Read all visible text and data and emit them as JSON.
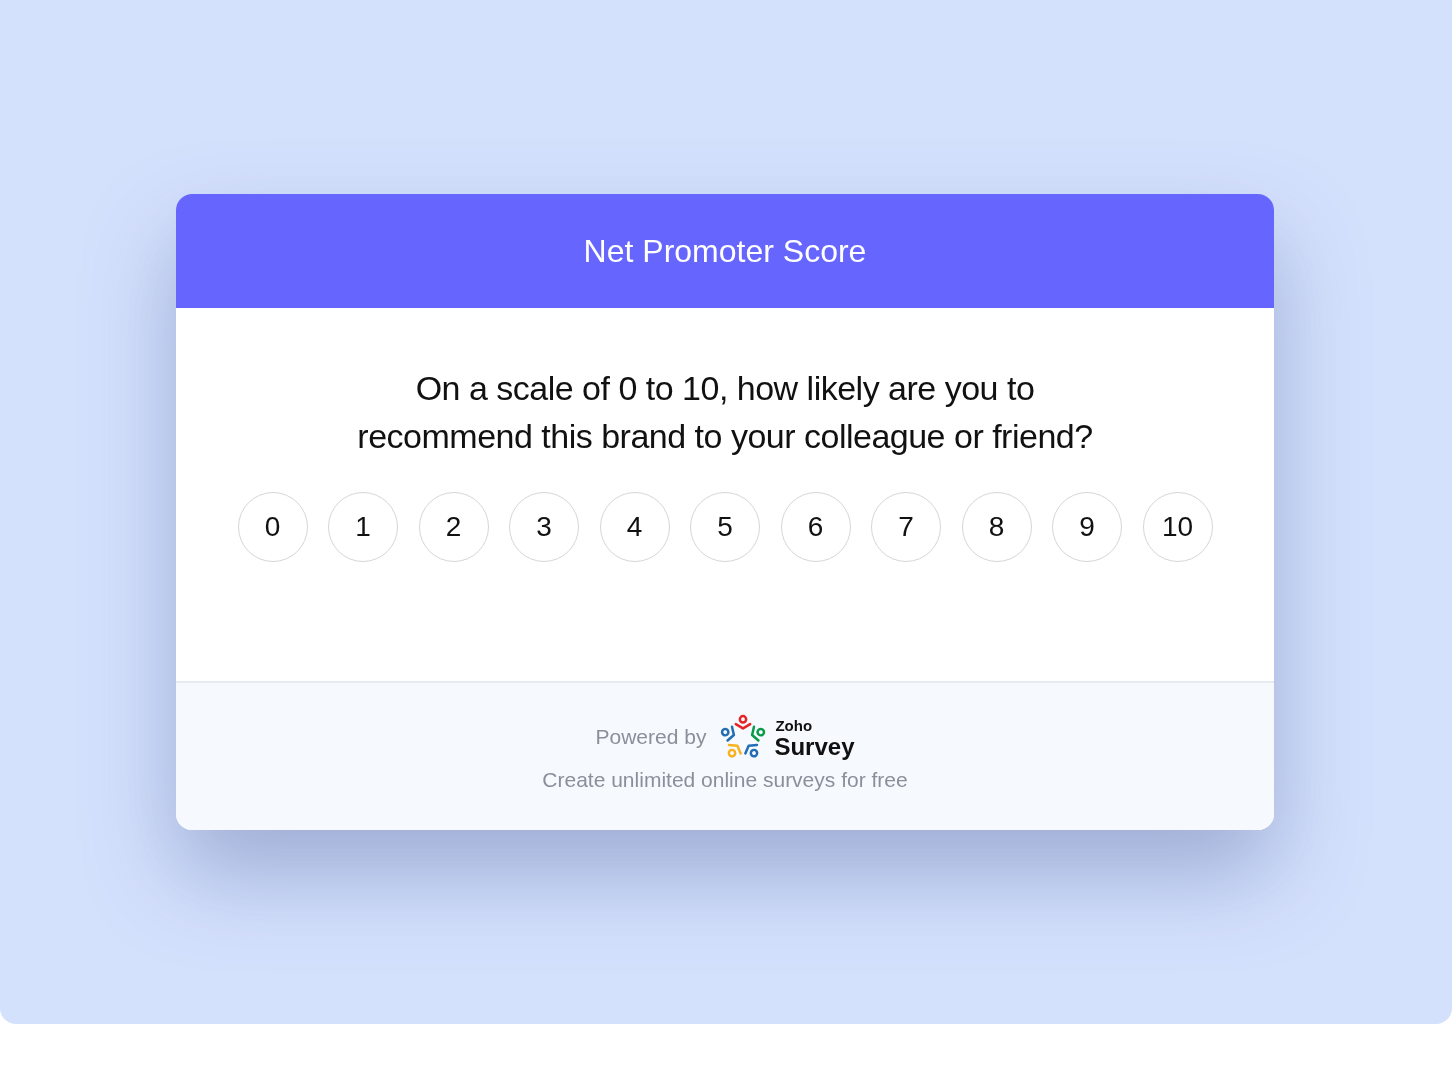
{
  "header": {
    "title": "Net Promoter Score"
  },
  "question": {
    "lines": [
      "On a scale of 0 to 10, how likely are you to",
      "recommend this brand to your colleague or friend?"
    ]
  },
  "scale": [
    {
      "label": "0",
      "selected": false
    },
    {
      "label": "1",
      "selected": false
    },
    {
      "label": "2",
      "selected": false
    },
    {
      "label": "3",
      "selected": false
    },
    {
      "label": "4",
      "selected": false
    },
    {
      "label": "5",
      "selected": false
    },
    {
      "label": "6",
      "selected": false
    },
    {
      "label": "7",
      "selected": false
    },
    {
      "label": "8",
      "selected": false
    },
    {
      "label": "9",
      "selected": false
    },
    {
      "label": "10",
      "selected": false
    }
  ],
  "footer": {
    "powered_by": "Powered by",
    "brand": {
      "company": "Zoho",
      "product": "Survey"
    },
    "tagline": "Create unlimited online surveys for free"
  }
}
